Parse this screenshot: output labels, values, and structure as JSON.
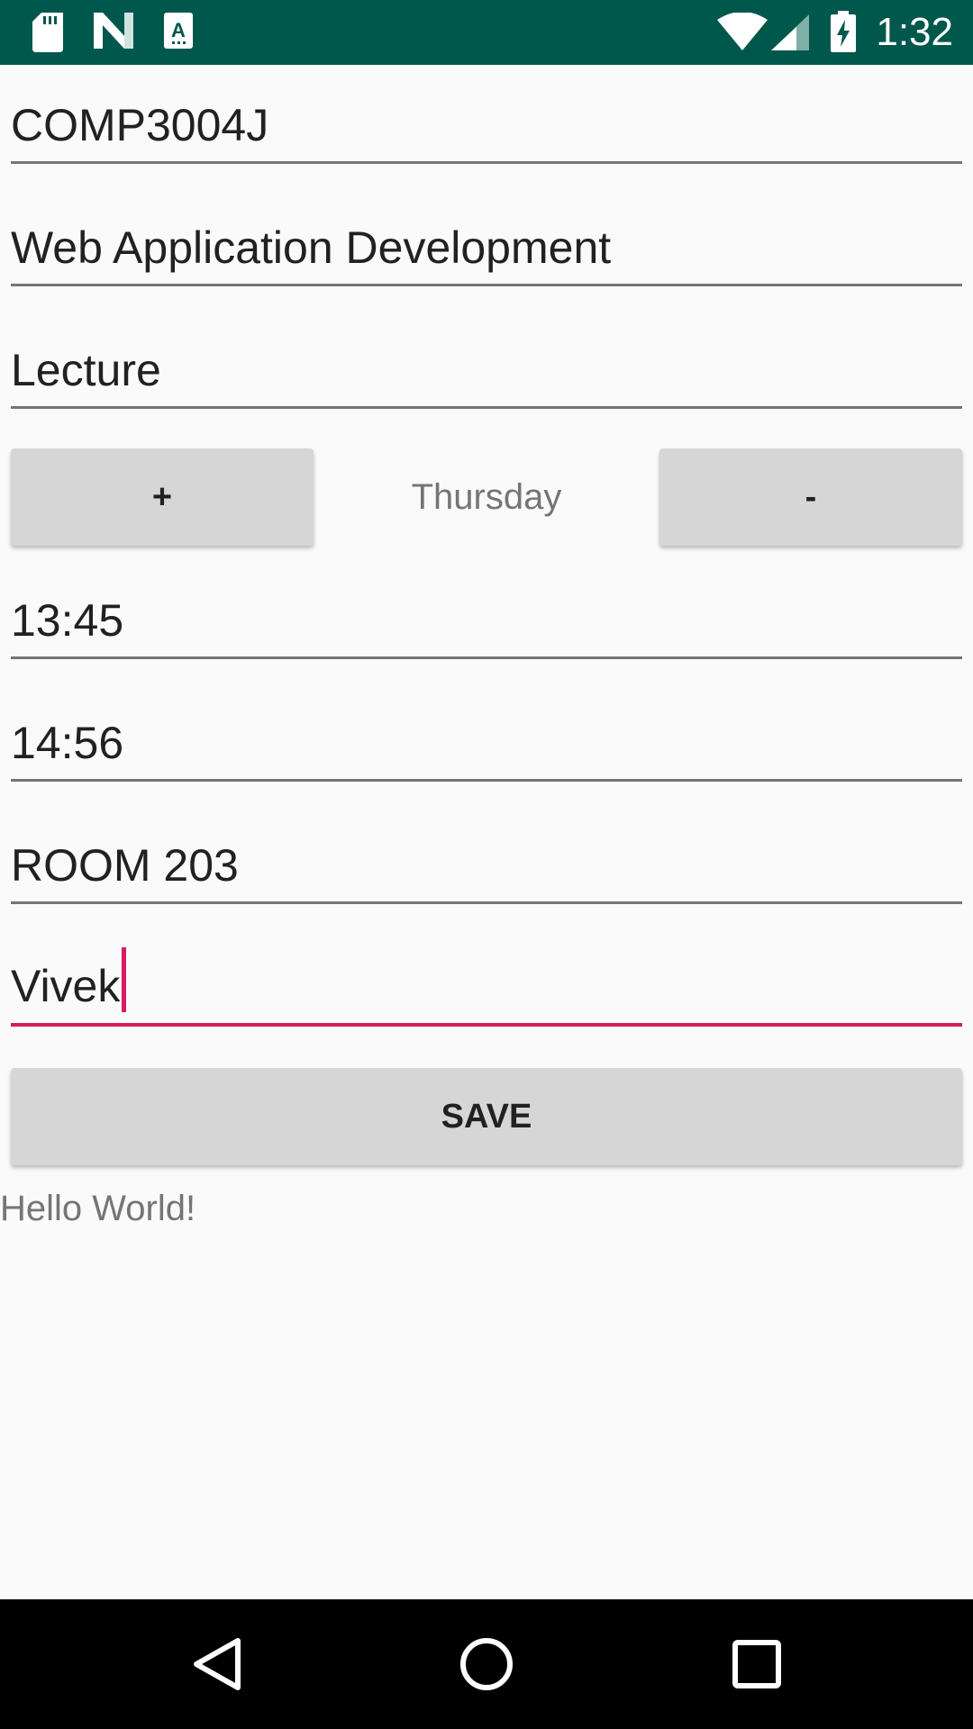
{
  "colors": {
    "status_bar": "#00574b",
    "accent": "#d81b60",
    "button_bg": "#d6d6d6",
    "background": "#fafafa"
  },
  "status_bar": {
    "time": "1:32",
    "icons": [
      "sd-card-icon",
      "n-notification-icon",
      "keyboard-a-icon",
      "wifi-icon",
      "cell-signal-icon",
      "battery-charging-icon"
    ]
  },
  "form": {
    "module_code": "COMP3004J",
    "module_name": "Web Application Development",
    "class_type": "Lecture",
    "day": {
      "plus_label": "+",
      "value": "Thursday",
      "minus_label": "-"
    },
    "start_time": "13:45",
    "end_time": "14:56",
    "room": "ROOM 203",
    "lecturer": "Vivek",
    "save_label": "SAVE"
  },
  "footer_text": "Hello World!",
  "nav_bar": {
    "icons": [
      "back-icon",
      "home-icon",
      "recents-icon"
    ]
  }
}
